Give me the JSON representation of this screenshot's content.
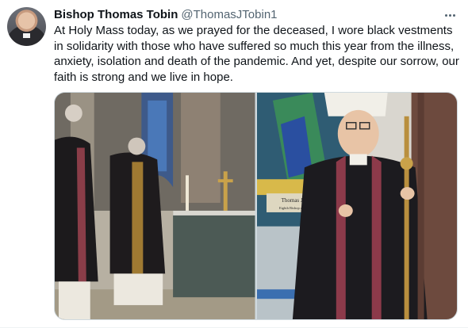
{
  "tweet": {
    "author_name": "Bishop Thomas Tobin",
    "author_handle": "@ThomasJTobin1",
    "text": "At Holy Mass today, as we prayed for the deceased, I wore black vestments in solidarity with those who have suffered so much this year from the illness, anxiety, isolation and death of the pandemic. And yet, despite our sorrow, our faith is strong and we live in hope.",
    "images": [
      {
        "icon": "altar-mass-photo"
      },
      {
        "icon": "bishop-portrait-photo",
        "plaque_line1": "Thomas J. Tobin",
        "plaque_line2": "Eighth Bishop of Providence"
      }
    ]
  },
  "colors": {
    "text_primary": "#0f1419",
    "text_secondary": "#536471",
    "border": "#cfd9de"
  }
}
